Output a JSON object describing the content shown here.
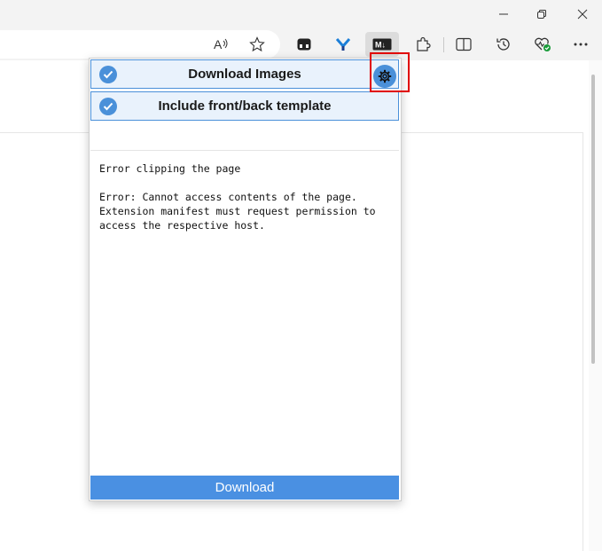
{
  "browser": {
    "window_controls": {
      "minimize_icon": "minimize-icon",
      "restore_icon": "restore-icon",
      "close_icon": "close-icon"
    },
    "toolbar_icons": [
      "read-aloud-icon",
      "favorite-star-icon",
      "extension-icon",
      "extension-y-icon",
      "markdown-extension-icon",
      "extensions-puzzle-icon",
      "split-screen-icon",
      "history-icon",
      "browser-essentials-icon",
      "more-menu-icon"
    ]
  },
  "popup": {
    "options": [
      {
        "label": "Download Images",
        "checked": true
      },
      {
        "label": "Include front/back template",
        "checked": true
      }
    ],
    "log_lines": [
      "Error clipping the page",
      "",
      "Error: Cannot access contents of the page.",
      "Extension manifest must request permission to",
      "access the respective host."
    ],
    "download_label": "Download"
  },
  "colors": {
    "accent": "#4a90e2",
    "option_bg": "#e9f2fc",
    "highlight": "#e00000"
  }
}
